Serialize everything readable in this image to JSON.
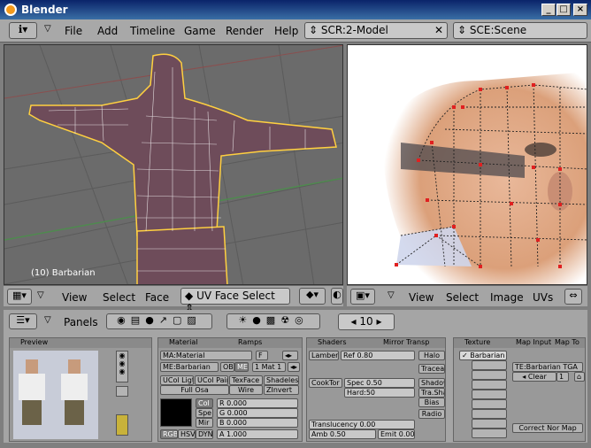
{
  "window": {
    "title": "Blender"
  },
  "menu": {
    "items": [
      "File",
      "Add",
      "Timeline",
      "Game",
      "Render",
      "Help"
    ],
    "screen": "SCR:2-Model",
    "scene": "SCE:Scene"
  },
  "viewport": {
    "object_label": "(10) Barbarian",
    "menu": [
      "View",
      "Select",
      "Face"
    ],
    "mode": "UV Face Select"
  },
  "uv_editor": {
    "menu": [
      "View",
      "Select",
      "Image",
      "UVs"
    ]
  },
  "buttons_header": {
    "panels_label": "Panels",
    "frame": "10"
  },
  "preview": {
    "title": "Preview"
  },
  "material": {
    "tabs": [
      "Material",
      "Ramps"
    ],
    "ma_name": "MA:Material",
    "f_label": "F",
    "me_name": "ME:Barbarian",
    "ob_label": "OB",
    "me_label": "ME",
    "mat_count": "1 Mat 1",
    "toggles": [
      "UCol Ligt",
      "UCol Pain",
      "TexFace",
      "Shadeles",
      "Full Osa",
      "Wire",
      "ZInvert"
    ],
    "col_labels": [
      "Col",
      "Spe",
      "Mir"
    ],
    "rgb": [
      "R 0.000",
      "G 0.000",
      "B 0.000"
    ],
    "modes": [
      "RGB",
      "HSV",
      "DYN"
    ],
    "alpha": "A 1.000"
  },
  "shaders": {
    "tabs": [
      "Shaders",
      "Mirror Transp"
    ],
    "diffuse": "Lambert",
    "ref": "Ref  0.80",
    "specular": "CookTor",
    "spec": "Spec 0.50",
    "hard": "Hard:50",
    "buttons": [
      "Halo",
      "Traceabl",
      "Shadow",
      "Tra.Sha",
      "Bias",
      "Radio"
    ],
    "translucency": "Translucency 0.00",
    "amb": "Amb 0.50",
    "emit": "Emit 0.00"
  },
  "texture": {
    "tabs": [
      "Texture",
      "Map Input",
      "Map To"
    ],
    "slot": "Barbarian",
    "te_name": "TE:Barbarian TGA",
    "clear": "Clear",
    "users": "1",
    "correct": "Correct Nor Map"
  }
}
